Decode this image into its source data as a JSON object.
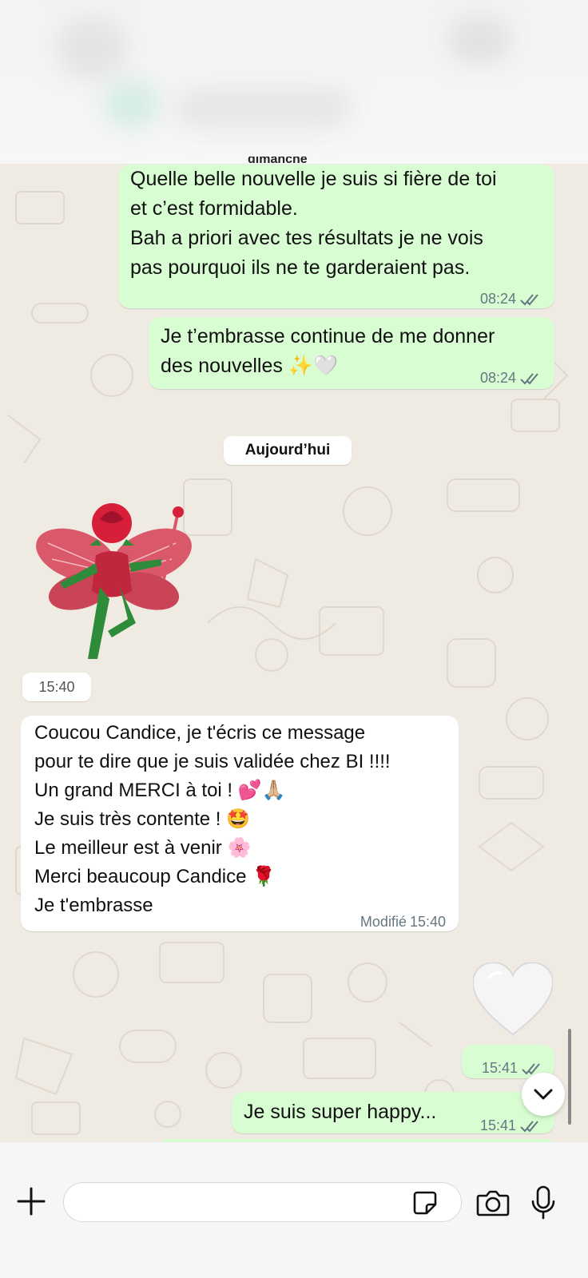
{
  "header": {
    "partial_date": "dimanche"
  },
  "messages": {
    "m1": {
      "text": "Quelle belle nouvelle je suis si fière de toi\net c’est formidable.\nBah a priori avec tes résultats je ne vois\npas pourquoi ils ne te garderaient pas.",
      "time": "08:24"
    },
    "m2": {
      "text": "Je t’embrasse continue de me donner\ndes nouvelles ✨🤍",
      "time": "08:24"
    },
    "day_separator": "Aujourd’hui",
    "sticker": {
      "name": "rose-fairy-sticker",
      "time": "15:40"
    },
    "m3": {
      "text": "Coucou Candice, je t'écris ce message\npour te dire que je suis validée chez BI !!!!\nUn grand MERCI à toi ! 💕🙏🏼\nJe suis très contente ! 🤩\nLe meilleur est à venir 🌸\nMerci beaucoup Candice 🌹\nJe t'embrasse",
      "edited_label": "Modifié",
      "time": "15:40"
    },
    "heart": {
      "emoji": "🤍",
      "time": "15:41"
    },
    "m4": {
      "text": "Je suis super happy...",
      "time": "15:41"
    }
  },
  "colors": {
    "outgoing_bubble": "#d9fdd3",
    "incoming_bubble": "#ffffff",
    "background": "#efeae2",
    "read_ticks": "#667781"
  },
  "composer": {
    "input_value": "",
    "icons": [
      "plus-icon",
      "sticker-icon",
      "camera-icon",
      "microphone-icon"
    ]
  }
}
